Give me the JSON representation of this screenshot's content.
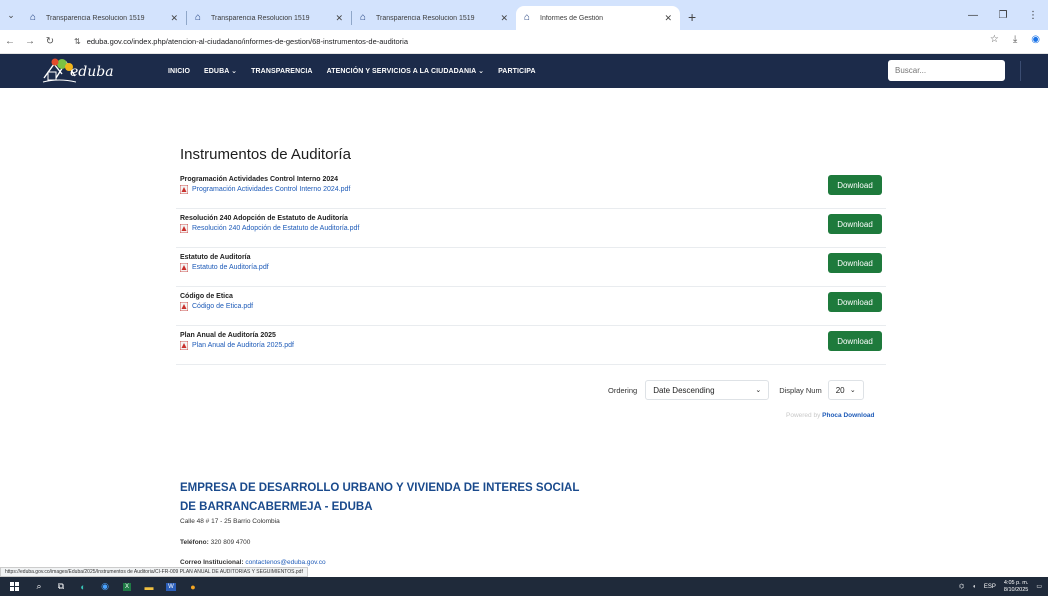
{
  "browser": {
    "tabs": [
      {
        "title": "Transparencia Resolucion 1519"
      },
      {
        "title": "Transparencia Resolucion 1519"
      },
      {
        "title": "Transparencia Resolucion 1519"
      },
      {
        "title": "Informes de Gestión"
      }
    ],
    "url": "eduba.gov.co/index.php/atencion-al-ciudadano/informes-de-gestion/68-instrumentos-de-auditoria"
  },
  "site": {
    "logo_text": "eduba",
    "nav": [
      "INICIO",
      "EDUBA ⌄",
      "TRANSPARENCIA",
      "ATENCIÓN Y SERVICIOS A LA CIUDADANIA ⌄",
      "PARTICIPA"
    ],
    "search_placeholder": "Buscar..."
  },
  "main": {
    "heading": "Instrumentos de Auditoría",
    "download_label": "Download",
    "files": [
      {
        "title": "Programación Actividades Control Interno 2024",
        "file": "Programación Actividades Control Interno 2024.pdf"
      },
      {
        "title": "Resolución 240 Adopción de Estatuto de Auditoría",
        "file": "Resolución 240 Adopción de Estatuto de Auditoría.pdf"
      },
      {
        "title": "Estatuto de Auditoría",
        "file": "Estatuto de Auditoría.pdf"
      },
      {
        "title": "Código de Etica",
        "file": "Código de Etica.pdf"
      },
      {
        "title": "Plan Anual de Auditoría 2025",
        "file": "Plan Anual de Auditoría 2025.pdf"
      }
    ],
    "ordering_label": "Ordering",
    "ordering_value": "Date Descending",
    "display_label": "Display Num",
    "display_value": "20",
    "powered_prefix": "Powered by",
    "powered_link": "Phoca Download"
  },
  "footer": {
    "title_line1": "EMPRESA DE DESARROLLO URBANO Y VIVIENDA DE INTERES SOCIAL",
    "title_line2": "DE BARRANCABERMEJA - EDUBA",
    "address": "Calle 48 # 17 - 25 Barrio Colombia",
    "phone_label": "Teléfono:",
    "phone": "320 809 4700",
    "email_label": "Correo Institucional:",
    "email": "contactenos@eduba.gov.co"
  },
  "status_url": "https://eduba.gov.co/images/Eduba/2025/Instrumentos de Auditoria/CI-FR-009 PLAN ANUAL DE AUDITORIAS Y SEGUIMIENTOS.pdf",
  "taskbar": {
    "lang": "ESP",
    "time": "4:05 p. m.",
    "date": "8/10/2025"
  },
  "colors": {
    "nav_bg": "#1c2b4a",
    "download_bg": "#1e7a3c",
    "link": "#1e5bb8",
    "footer_title": "#1a4a8c"
  }
}
